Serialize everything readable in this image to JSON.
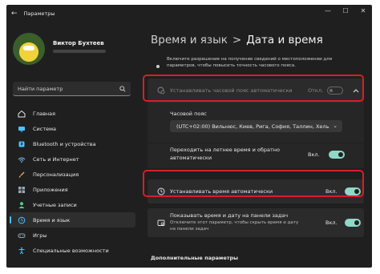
{
  "window": {
    "title": "Параметры"
  },
  "user": {
    "name": "Виктор Бухтеев"
  },
  "search": {
    "placeholder": "Найти параметр"
  },
  "sidebar": {
    "items": [
      {
        "label": "Главная",
        "icon": "home-icon",
        "color": "#e8e8e8"
      },
      {
        "label": "Система",
        "icon": "system-icon",
        "color": "#4cc2ff"
      },
      {
        "label": "Bluetooth и устройства",
        "icon": "bluetooth-icon",
        "color": "#4cc2ff"
      },
      {
        "label": "Сеть и Интернет",
        "icon": "network-icon",
        "color": "#7ecbff"
      },
      {
        "label": "Персонализация",
        "icon": "brush-icon",
        "color": "#f0a060"
      },
      {
        "label": "Приложения",
        "icon": "apps-icon",
        "color": "#9aa6b2"
      },
      {
        "label": "Учетные записи",
        "icon": "accounts-icon",
        "color": "#4fd08a"
      },
      {
        "label": "Время и язык",
        "icon": "time-language-icon",
        "color": "#4cc2ff"
      },
      {
        "label": "Игры",
        "icon": "gaming-icon",
        "color": "#9aa6b2"
      },
      {
        "label": "Специальные возможности",
        "icon": "accessibility-icon",
        "color": "#4cc2ff"
      }
    ]
  },
  "breadcrumb": {
    "parent": "Время и язык",
    "separator": ">",
    "current": "Дата и время"
  },
  "location_note": {
    "line1": "Включите разрешение на получение сведений о местоположении для",
    "line2": "параметров, чтобы повысить точность часового пояса."
  },
  "auto_timezone": {
    "label": "Устанавливать часовой пояс автоматически",
    "state": "Откл."
  },
  "timezone": {
    "label": "Часовой пояс",
    "value": "(UTC+02:00) Вильнюс, Киев, Рига, София, Таллин, Хель"
  },
  "dst": {
    "line1": "Переходить на летнее время и обратно",
    "line2": "автоматически",
    "state": "Вкл."
  },
  "auto_time": {
    "label": "Устанавливать время автоматически",
    "state": "Вкл."
  },
  "taskbar_time": {
    "label": "Показывать время и дату на панели задач",
    "desc1": "Отключите этот параметр, чтобы скрыть время и дату",
    "desc2": "на панели задач",
    "state": "Вкл."
  },
  "additional": {
    "heading": "Дополнительные параметры"
  },
  "colors": {
    "accent": "#4cc2ff",
    "toggle_on": "#8fd8c8",
    "highlight": "#d61f2a"
  }
}
